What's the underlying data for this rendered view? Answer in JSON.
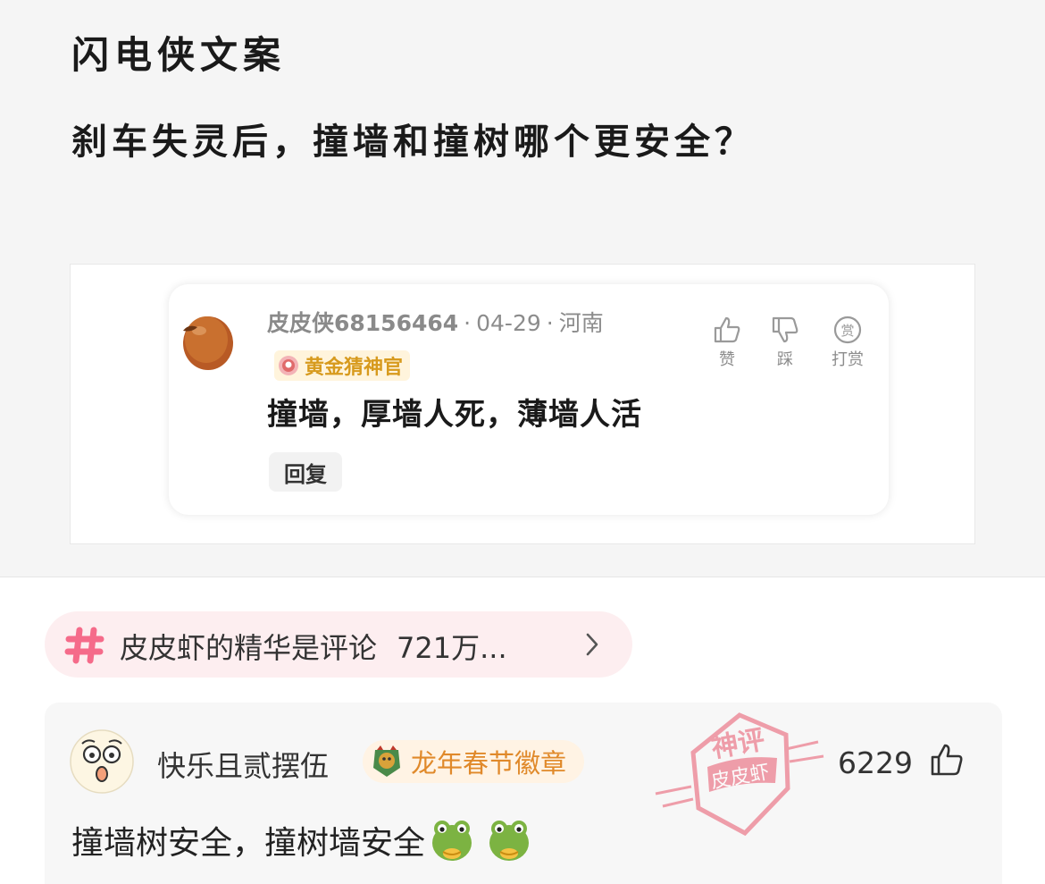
{
  "post": {
    "author": "闪电侠文案",
    "title": "刹车失灵后，撞墙和撞树哪个更安全？",
    "quoted_comment": {
      "username": "皮皮侠68156464",
      "date": "04-29",
      "location": "河南",
      "badge": "黄金猜神官",
      "text": "撞墙，厚墙人死，薄墙人活",
      "reply_label": "回复",
      "actions": {
        "like": "赞",
        "dislike": "踩",
        "tip": "打赏",
        "tip_icon_char": "赏"
      }
    }
  },
  "topic": {
    "name": "皮皮虾的精华是评论",
    "count": "721万..."
  },
  "hot_comment": {
    "username": "快乐且贰摆伍",
    "badge": "龙年春节徽章",
    "like_count": "6229",
    "text": "撞墙树安全，撞树墙安全",
    "emojis": [
      "frog-emoji",
      "frog-emoji"
    ],
    "stamp": {
      "top": "神评",
      "bottom": "皮皮虾"
    }
  },
  "colors": {
    "topic_bg": "#fdeef0",
    "hash": "#f56b8a",
    "badge_gold": "#d79a1d",
    "stamp_red": "#e8556a",
    "badge_orange": "#e0892a"
  }
}
